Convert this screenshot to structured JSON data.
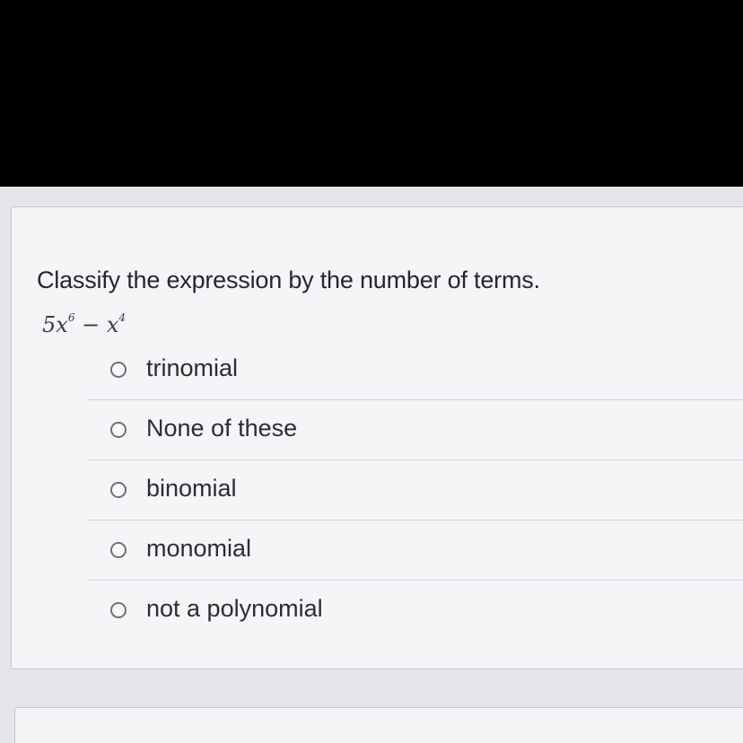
{
  "question": {
    "text": "Classify the expression by the number of terms.",
    "expression": {
      "coef1": "5",
      "var1": "x",
      "exp1": "6",
      "operator": "−",
      "var2": "x",
      "exp2": "4"
    }
  },
  "options": [
    {
      "label": "trinomial",
      "selected": false
    },
    {
      "label": "None of these",
      "selected": false
    },
    {
      "label": "binomial",
      "selected": false
    },
    {
      "label": "monomial",
      "selected": false
    },
    {
      "label": "not a polynomial",
      "selected": false
    }
  ]
}
